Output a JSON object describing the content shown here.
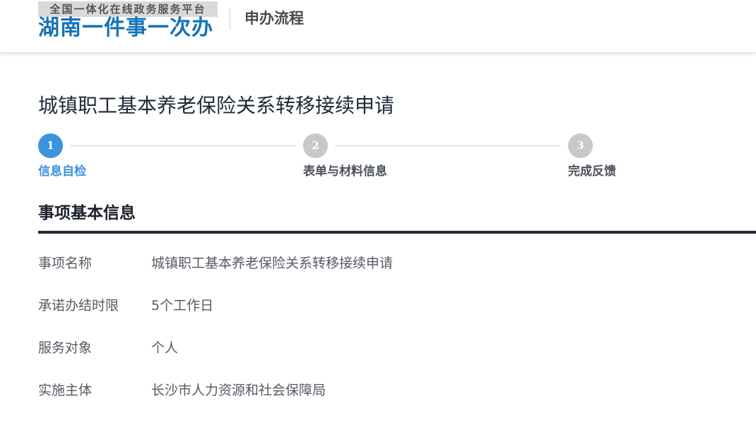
{
  "header": {
    "logo_subtitle": "全国一体化在线政务服务平台",
    "logo_title": "湖南一件事一次办",
    "page_label": "申办流程"
  },
  "main": {
    "title": "城镇职工基本养老保险关系转移接续申请",
    "steps": [
      {
        "number": "1",
        "label": "信息自检",
        "state": "active"
      },
      {
        "number": "2",
        "label": "表单与材料信息",
        "state": "inactive"
      },
      {
        "number": "3",
        "label": "完成反馈",
        "state": "inactive"
      }
    ],
    "section_title": "事项基本信息",
    "info": [
      {
        "label": "事项名称",
        "value": "城镇职工基本养老保险关系转移接续申请"
      },
      {
        "label": "承诺办结时限",
        "value": "5个工作日"
      },
      {
        "label": "服务对象",
        "value": "个人"
      },
      {
        "label": "实施主体",
        "value": "长沙市人力资源和社会保障局"
      }
    ]
  },
  "colors": {
    "brand_blue": "#1673b8",
    "step_active": "#3c93de",
    "step_inactive": "#c8c8c8",
    "section_rule": "#1f2733"
  }
}
